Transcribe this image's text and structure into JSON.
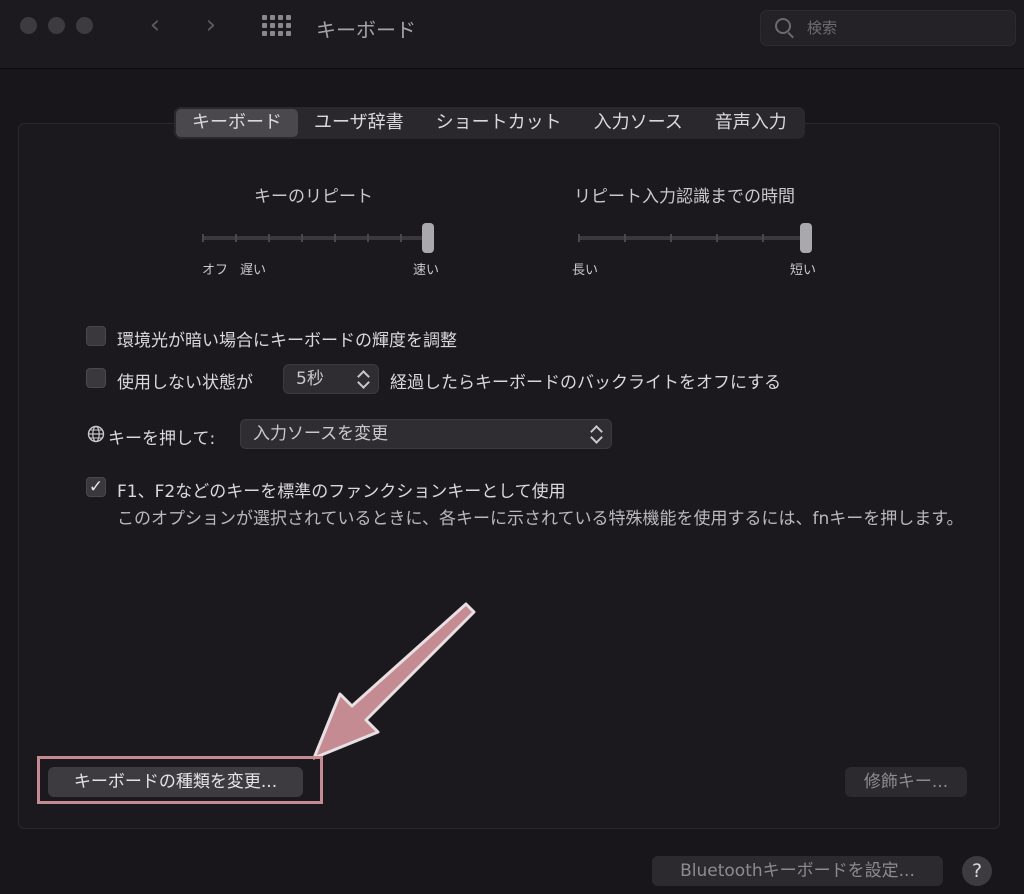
{
  "window": {
    "title": "キーボード"
  },
  "toolbar": {
    "back_icon": "chevron-left-icon",
    "forward_icon": "chevron-right-icon",
    "grid_icon": "grid-icon",
    "search_placeholder": "検索"
  },
  "tabs": [
    {
      "label": "キーボード",
      "selected": true
    },
    {
      "label": "ユーザ辞書",
      "selected": false
    },
    {
      "label": "ショートカット",
      "selected": false
    },
    {
      "label": "入力ソース",
      "selected": false
    },
    {
      "label": "音声入力",
      "selected": false
    }
  ],
  "key_repeat": {
    "title": "キーのリピート",
    "left_label_1": "オフ",
    "left_label_2": "遅い",
    "right_label": "速い",
    "value_fraction": 1.0
  },
  "repeat_delay": {
    "title": "リピート入力認識までの時間",
    "left_label": "長い",
    "right_label": "短い",
    "value_fraction": 1.0
  },
  "options": {
    "ambient_light": {
      "label": "環境光が暗い場合にキーボードの輝度を調整",
      "checked": false
    },
    "backlight_off": {
      "label_before": "使用しない状態が",
      "stepper_value": "5秒",
      "label_after": "経過したらキーボードのバックライトをオフにする",
      "checked": false
    },
    "globe_key": {
      "label": "キーを押して:",
      "selected": "入力ソースを変更"
    },
    "fn_keys": {
      "label": "F1、F2などのキーを標準のファンクションキーとして使用",
      "description": "このオプションが選択されているときに、各キーに示されている特殊機能を使用するには、fnキーを押します。",
      "checked": true
    }
  },
  "buttons": {
    "change_keyboard_type": "キーボードの種類を変更...",
    "modifier_keys": "修飾キー...",
    "bluetooth_setup": "Bluetoothキーボードを設定...",
    "help": "?"
  },
  "colors": {
    "background": "#18161b",
    "annotation": "#c48b92"
  }
}
